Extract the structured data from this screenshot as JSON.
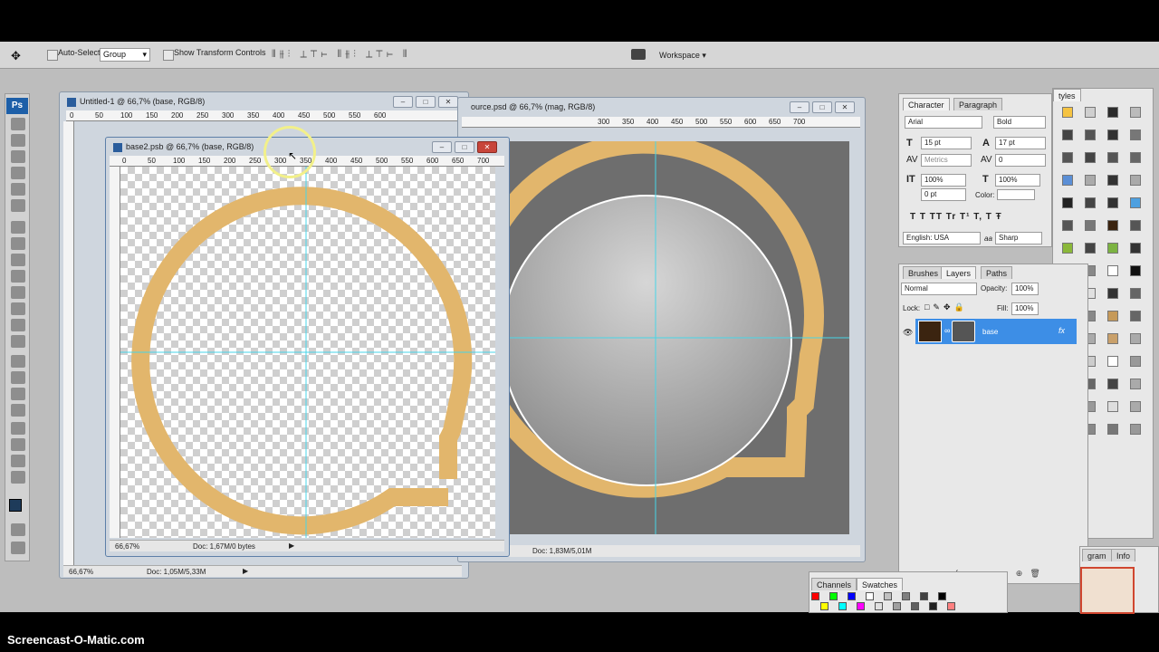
{
  "options_bar": {
    "auto_select_label": "Auto-Select:",
    "auto_select_value": "Group",
    "show_transform_label": "Show Transform Controls",
    "workspace_label": "Workspace ▾"
  },
  "app": {
    "logo": "Ps"
  },
  "windows": {
    "untitled": {
      "title": "Untitled-1 @ 66,7% (base, RGB/8)",
      "zoom": "66,67%",
      "doc": "Doc: 1,05M/5,33M",
      "ruler_ticks": [
        "0",
        "50",
        "100",
        "150",
        "200",
        "250",
        "300",
        "350",
        "400",
        "450",
        "500",
        "550",
        "600"
      ]
    },
    "source": {
      "title": "ource.psd @ 66,7% (mag, RGB/8)",
      "doc": "Doc: 1,83M/5,01M",
      "ruler_ticks": [
        "300",
        "350",
        "400",
        "450",
        "500",
        "550",
        "600",
        "650",
        "700"
      ]
    },
    "base2": {
      "title": "base2.psb @ 66,7% (base, RGB/8)",
      "zoom": "66,67%",
      "doc": "Doc: 1,67M/0 bytes",
      "ruler_ticks": [
        "0",
        "50",
        "100",
        "150",
        "200",
        "250",
        "300",
        "350",
        "400",
        "450",
        "500",
        "550",
        "600",
        "650",
        "700"
      ]
    }
  },
  "character_panel": {
    "tabs": [
      "Character",
      "Paragraph"
    ],
    "font_family": "Arial",
    "font_style": "Bold",
    "font_size": "15 pt",
    "leading": "17 pt",
    "kerning": "Metrics",
    "tracking": "0",
    "vscale": "100%",
    "hscale": "100%",
    "baseline": "0 pt",
    "color_label": "Color:",
    "style_buttons": "T  T  TT Tr T¹ T,  T  Ŧ",
    "language": "English: USA",
    "antialias_symbol": "aa",
    "antialias": "Sharp"
  },
  "styles_tab": "tyles",
  "layers_panel": {
    "tabs": [
      "Brushes",
      "Layers",
      "Paths"
    ],
    "blend_mode": "Normal",
    "opacity_label": "Opacity:",
    "opacity": "100%",
    "lock_label": "Lock:",
    "fill_label": "Fill:",
    "fill": "100%",
    "layer_name": "base",
    "fx": "fx"
  },
  "channels_panel": {
    "tabs": [
      "Channels",
      "Swatches"
    ]
  },
  "info_panel": {
    "tabs": [
      "gram",
      "Info"
    ]
  },
  "caption": "Screencast-O-Matic.com",
  "colors": {
    "ring_gold": "#e2b66c",
    "ring_dark": "#b98b3e",
    "canvas_grey": "#6e6e6e",
    "guide": "#47d6e8",
    "layer_selected": "#3d8ee6",
    "highlight_circle": "#f2f08a"
  }
}
